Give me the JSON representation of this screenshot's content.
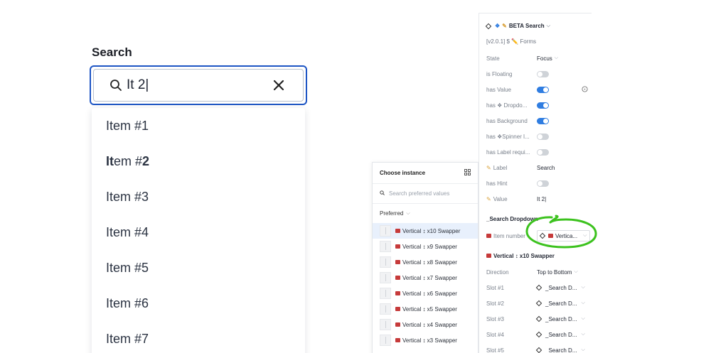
{
  "search_demo": {
    "title": "Search",
    "input_value": "It 2|",
    "items": [
      {
        "prefix": "",
        "bold": "",
        "suffix": "Item #1"
      },
      {
        "prefix": "",
        "bold": "It",
        "suffix": "em #",
        "bold2": "2"
      },
      {
        "prefix": "",
        "bold": "",
        "suffix": "Item #3"
      },
      {
        "prefix": "",
        "bold": "",
        "suffix": "Item #4"
      },
      {
        "prefix": "",
        "bold": "",
        "suffix": "Item #5"
      },
      {
        "prefix": "",
        "bold": "",
        "suffix": "Item #6"
      },
      {
        "prefix": "",
        "bold": "",
        "suffix": "Item #7"
      }
    ]
  },
  "instance_panel": {
    "title": "Choose instance",
    "search_placeholder": "Search preferred values",
    "preferred_label": "Preferred",
    "items": [
      "Vertical ↕ x10 Swapper",
      "Vertical ↕ x9 Swapper",
      "Vertical ↕ x8 Swapper",
      "Vertical ↕ x7 Swapper",
      "Vertical ↕ x6 Swapper",
      "Vertical ↕ x5 Swapper",
      "Vertical ↕ x4 Swapper",
      "Vertical ↕ x3 Swapper"
    ]
  },
  "props_panel": {
    "title": "BETA Search",
    "version": "[v2.0.1] $ ✏️ Forms",
    "state_label": "State",
    "state_value": "Focus",
    "is_floating_label": "is Floating",
    "has_value_label": "has Value",
    "has_dropdown_label": "has ❖ Dropdo...",
    "has_background_label": "has Background",
    "has_spinner_label": "has ❖Spinner l...",
    "has_label_required_label": "has Label requi...",
    "label_label": "Label",
    "label_value": "Search",
    "has_hint_label": "has Hint",
    "value_label": "Value",
    "value_value": "It 2|",
    "section_dropdown": "_Search Dropdown",
    "item_number_label": "Item number",
    "item_number_value": "Vertica...",
    "section_vertical": "Vertical ↕ x10  Swapper",
    "direction_label": "Direction",
    "direction_value": "Top to Bottom",
    "slots": [
      {
        "label": "Slot #1",
        "value": "_Search D..."
      },
      {
        "label": "Slot #2",
        "value": "_Search D..."
      },
      {
        "label": "Slot #3",
        "value": "_Search D..."
      },
      {
        "label": "Slot #4",
        "value": "_Search D..."
      },
      {
        "label": "Slot #5",
        "value": "_Search D..."
      }
    ]
  },
  "colors": {
    "focus_border": "#1d55c4",
    "toggle_on": "#2f7de1",
    "annotation": "#3cc21e"
  }
}
